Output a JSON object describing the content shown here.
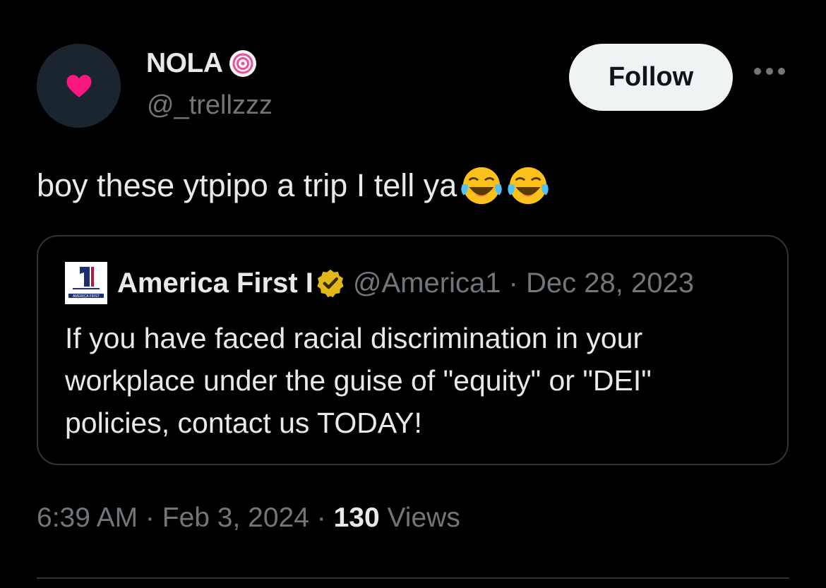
{
  "tweet": {
    "author": {
      "display_name": "NOLA",
      "handle": "@_trellzzz",
      "avatar_icon": "pink-heart-icon",
      "name_badge_icon": "pink-swirl-icon"
    },
    "follow_label": "Follow",
    "text": "boy these ytpipo a trip I tell ya",
    "emojis": [
      "face-with-tears-of-joy-icon",
      "face-with-tears-of-joy-icon"
    ],
    "timestamp": "6:39 AM · Feb 3, 2024 · ",
    "views_count": "130",
    "views_label": " Views"
  },
  "quote": {
    "author": {
      "display_name": "America First I",
      "handle_date": "@America1 · Dec 28, 2023",
      "logo_text": "AMERICA FIRST",
      "badge_icon": "gold-verified-badge-icon"
    },
    "text": "If you have faced racial discrimination in your workplace under the guise of \"equity\" or \"DEI\" policies, contact us TODAY!"
  },
  "colors": {
    "background": "#000000",
    "text_primary": "#e7e9ea",
    "text_secondary": "#71767b",
    "border": "#2f3336",
    "heart": "#f91880",
    "gold_badge": "#e2b719"
  }
}
